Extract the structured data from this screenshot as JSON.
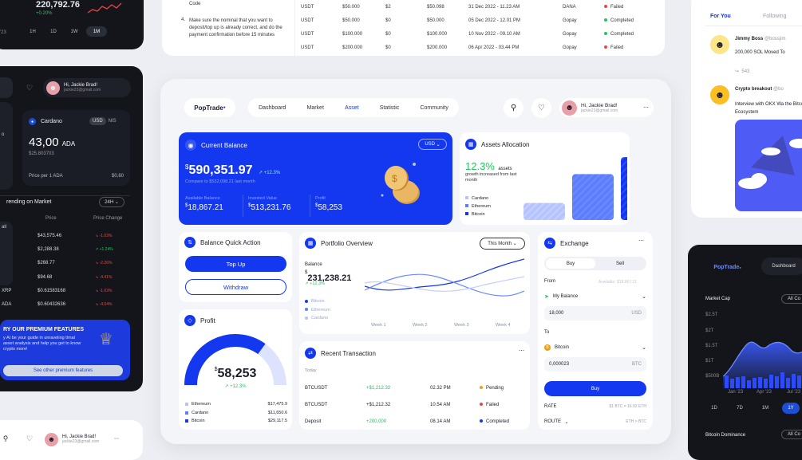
{
  "colors": {
    "brand": "#1437f0",
    "green": "#22c55e",
    "red": "#ef4444",
    "orange": "#f59e0b",
    "dark_bg": "#13151b"
  },
  "top_left": {
    "price": "220,792.76",
    "change": "+0.20%",
    "date_frag": "'23",
    "ranges": [
      "1H",
      "1D",
      "1W",
      "1M"
    ],
    "active_range": "1M"
  },
  "top_doc": {
    "item3_frag": "Code",
    "item4_num": "4.",
    "item4_text": "Make sure the nominal that you want to deposit/top up is already correct, and do the payment confirmation before 15 minutes"
  },
  "top_table": {
    "rows": [
      {
        "coin": "USDT",
        "amount": "$50.000",
        "fee": "$2",
        "total": "$50.098",
        "date": "31 Dec 2022 - 11.23 AM",
        "method": "DANA",
        "status": "Failed"
      },
      {
        "coin": "USDT",
        "amount": "$50.000",
        "fee": "$0",
        "total": "$50.000",
        "date": "05 Dec 2022 - 12.01 PM",
        "method": "Gopay",
        "status": "Completed"
      },
      {
        "coin": "USDT",
        "amount": "$100.000",
        "fee": "$0",
        "total": "$100.000",
        "date": "10 Nov 2022 - 09.10 AM",
        "method": "Gopay",
        "status": "Completed"
      },
      {
        "coin": "USDT",
        "amount": "$200.000",
        "fee": "$0",
        "total": "$200.000",
        "date": "06 Apr 2022 - 03.44 PM",
        "method": "Gopay",
        "status": "Failed"
      }
    ]
  },
  "left_dark": {
    "user": {
      "greeting": "Hi, Jackie Brad!",
      "email": "jackie23@gmail.com"
    },
    "coin": {
      "name": "Cardano",
      "cur1": "USD",
      "cur2": "NIS",
      "amount": "43,00",
      "unit": "ADA",
      "sub_prefix": "$",
      "sub": "25.803703",
      "price_label": "Price per 1 ADA",
      "price_val": "0,60"
    },
    "trending": {
      "title": "rending on Market",
      "period": "24H",
      "col_price": "Price",
      "col_change": "Price Change",
      "all_frag": "all",
      "item_frag": "o",
      "rows": [
        {
          "name": "",
          "price": "$43,575.46",
          "change": "-1.03%"
        },
        {
          "name": "",
          "price": "$2,288.38",
          "change": "+1.24%"
        },
        {
          "name": "",
          "price": "$268.77",
          "change": "-2.26%"
        },
        {
          "name": "",
          "price": "$94.68",
          "change": "-4.41%"
        },
        {
          "name": "XRP",
          "price": "$0.61583168",
          "change": "-1.03%"
        },
        {
          "name": "ADA",
          "price": "$0.60432636",
          "change": "-4.04%"
        }
      ]
    },
    "premium": {
      "title": "RY OUR PREMIUM FEATURES",
      "body": "y AI be your guide in unraveling timal asset analysis and help you get to know crypto more!",
      "button": "See other premium features"
    }
  },
  "bottom_left": {
    "greeting": "Hi, Jackie Brad!",
    "email": "jackie23@gmail.com"
  },
  "social": {
    "tabs": [
      "For You",
      "Following"
    ],
    "posts": [
      {
        "name": "Jimmy Boss",
        "handle": "@bossjim",
        "text": "200,000 SOL Moved To",
        "reposts": "543"
      },
      {
        "name": "Crypto breakout",
        "handle": "@bo",
        "text": "Interview with OKX Wa the Bitcoin Ecosystem"
      }
    ]
  },
  "right_dark": {
    "logo": "PopTrade",
    "nav": "Dashboard",
    "title": "Market Cap",
    "dropdown": "All Co",
    "yticks": [
      "$2.5T",
      "$2T",
      "$1.5T",
      "$1T",
      "$500B"
    ],
    "xticks": [
      "Jan '23",
      "Apr '23",
      "Jul '23"
    ],
    "ranges": [
      "1D",
      "7D",
      "1M",
      "1Y"
    ],
    "active_range": "1Y",
    "dominance": "Bitcoin Dominance",
    "dominance_dd": "All Co"
  },
  "main": {
    "logo": "PopTrade",
    "nav": [
      "Dashboard",
      "Market",
      "Asset",
      "Statistic",
      "Community"
    ],
    "active_nav": "Asset",
    "user": {
      "greeting": "Hi, Jackie Brad!",
      "email": "jackie23@gmail.com"
    },
    "balance": {
      "title": "Current Balance",
      "currency": "USD",
      "amount": "590,351.97",
      "change": "+12.3%",
      "compare": "Compare to $532,098.21 last month",
      "stats": [
        {
          "label": "Available Balance",
          "value": "18,867.21"
        },
        {
          "label": "Invested Value",
          "value": "513,231.76"
        },
        {
          "label": "Profit",
          "value": "58,253"
        }
      ]
    },
    "allocation": {
      "title": "Assets Allocation",
      "percent": "12.3%",
      "percent_suffix": "assets",
      "desc": "growth increased from last month",
      "legend": [
        "Cardano",
        "Ethereum",
        "Bitcoin"
      ]
    },
    "chart_data": {
      "type": "bar",
      "categories": [
        "Cardano",
        "Ethereum",
        "Bitcoin"
      ],
      "values": [
        20,
        54,
        74
      ],
      "title": "",
      "xlabel": "",
      "ylabel": ""
    },
    "quick": {
      "title": "Balance Quick Action",
      "top_up": "Top Up",
      "withdraw": "Withdraw"
    },
    "profit": {
      "title": "Profit",
      "amount": "58,253",
      "change": "+12.3%",
      "gauge_fraction": 0.7,
      "legend": [
        {
          "name": "Ethereum",
          "value": "$17,475.9"
        },
        {
          "name": "Cardano",
          "value": "$11,650.6"
        },
        {
          "name": "Bitcoin",
          "value": "$29,117.5"
        }
      ]
    },
    "portfolio": {
      "title": "Portfolio Overview",
      "period": "This Month",
      "balance_label": "Balance",
      "balance": "231,238.21",
      "change": "+12.3%",
      "legend": [
        "Bitcoin",
        "Ethereum",
        "Cardano"
      ],
      "weeks": [
        "Week 1",
        "Week 2",
        "Week 3",
        "Week 4"
      ]
    },
    "recent": {
      "title": "Recent Transaction",
      "today": "Today",
      "rows": [
        {
          "name": "BTCUSDT",
          "amount": "+$1,212.32",
          "time": "02.32 PM",
          "status": "Pending"
        },
        {
          "name": "BTCUSDT",
          "amount": "+$1,212.32",
          "time": "10.54 AM",
          "status": "Failed"
        },
        {
          "name": "Deposit",
          "amount": "+200,000",
          "time": "08.14 AM",
          "status": "Completed"
        }
      ]
    },
    "exchange": {
      "title": "Exchange",
      "buy": "Buy",
      "sell": "Sell",
      "from": "From",
      "available": "Available: $18,867.21",
      "my_balance": "My Balance",
      "from_value": "18,000",
      "from_unit": "USD",
      "to": "To",
      "to_coin": "Bitcoin",
      "to_value": "0,000023",
      "to_unit": "BTC",
      "button": "Buy",
      "rate_label": "RATE",
      "rate_val": "$1 BTC = 16.92 ETH",
      "route_label": "ROUTE",
      "route_val": "ETH > BTC"
    }
  }
}
